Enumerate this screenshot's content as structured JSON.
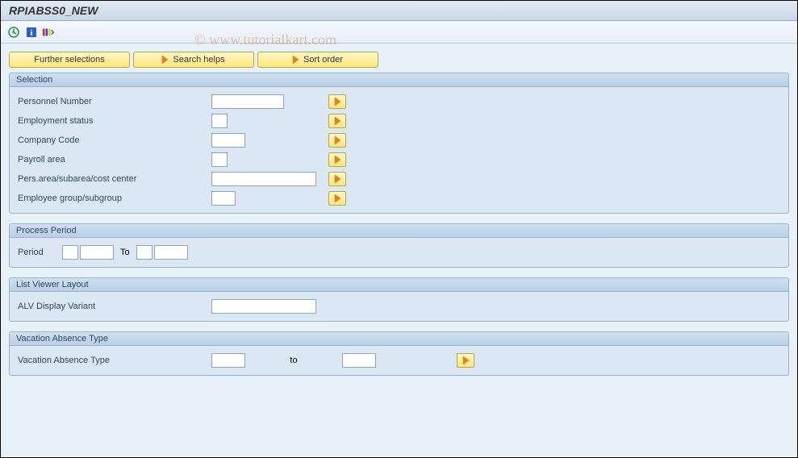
{
  "title": "RPIABSS0_NEW",
  "watermark": "© www.tutorialkart.com",
  "toolbar": {
    "icons": [
      "execute",
      "info",
      "layout-variant"
    ]
  },
  "buttons": {
    "further_selections": "Further selections",
    "search_helps": "Search helps",
    "sort_order": "Sort order"
  },
  "groups": {
    "selection": {
      "title": "Selection",
      "fields": {
        "personnel_number": {
          "label": "Personnel Number",
          "value": ""
        },
        "employment_status": {
          "label": "Employment status",
          "value": ""
        },
        "company_code": {
          "label": "Company Code",
          "value": ""
        },
        "payroll_area": {
          "label": "Payroll area",
          "value": ""
        },
        "pers_area": {
          "label": "Pers.area/subarea/cost center",
          "value": ""
        },
        "employee_group": {
          "label": "Employee group/subgroup",
          "value": ""
        }
      }
    },
    "process_period": {
      "title": "Process Period",
      "period_label": "Period",
      "to_label": "To",
      "from1": "",
      "from2": "",
      "to1": "",
      "to2": ""
    },
    "list_viewer": {
      "title": "List Viewer Layout",
      "alv_label": "ALV Display Variant",
      "alv_value": ""
    },
    "vacation": {
      "title": "Vacation Absence Type",
      "label": "Vacation Absence Type",
      "to_label": "to",
      "from": "",
      "to": ""
    }
  }
}
